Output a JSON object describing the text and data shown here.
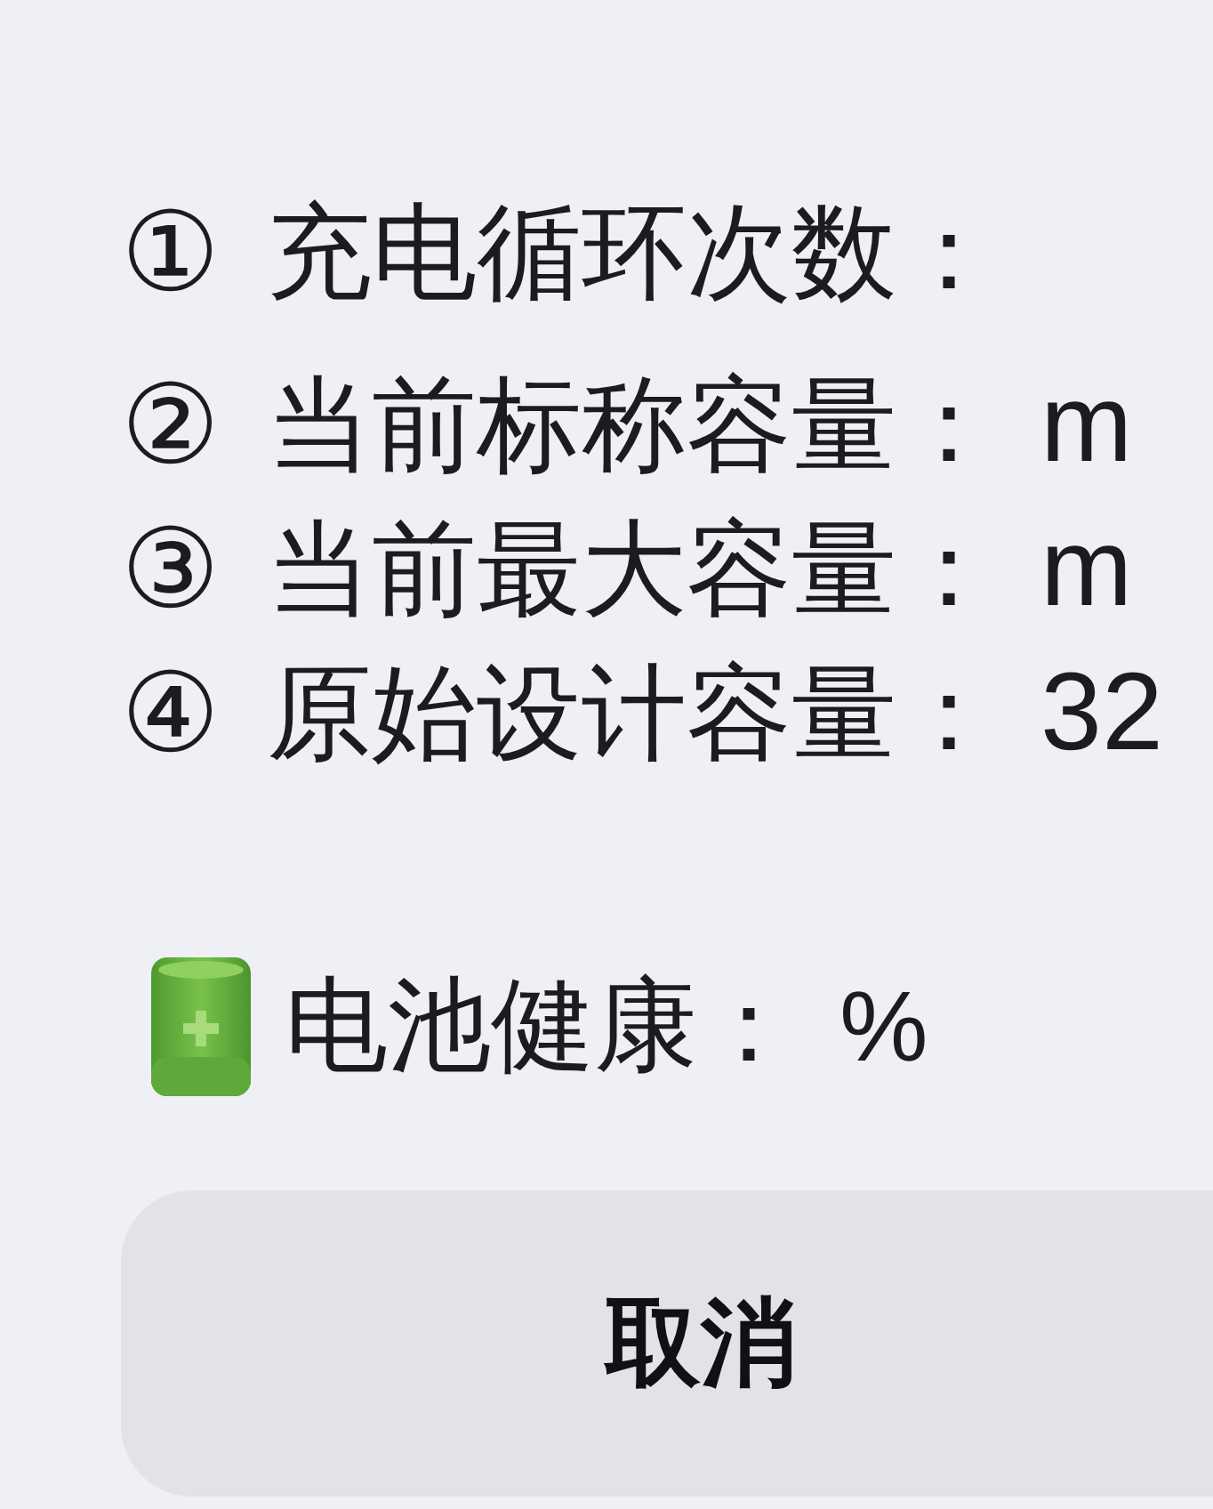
{
  "stats": [
    {
      "marker": "①",
      "label": "充电循环次数："
    },
    {
      "marker": "②",
      "label": "当前标称容量：",
      "value": "m"
    },
    {
      "marker": "③",
      "label": "当前最大容量：",
      "value": "m"
    },
    {
      "marker": "④",
      "label": "原始设计容量：",
      "value": "32"
    }
  ],
  "health": {
    "label": "电池健康：",
    "value": "%"
  },
  "buttons": [
    {
      "label": "取消"
    }
  ]
}
